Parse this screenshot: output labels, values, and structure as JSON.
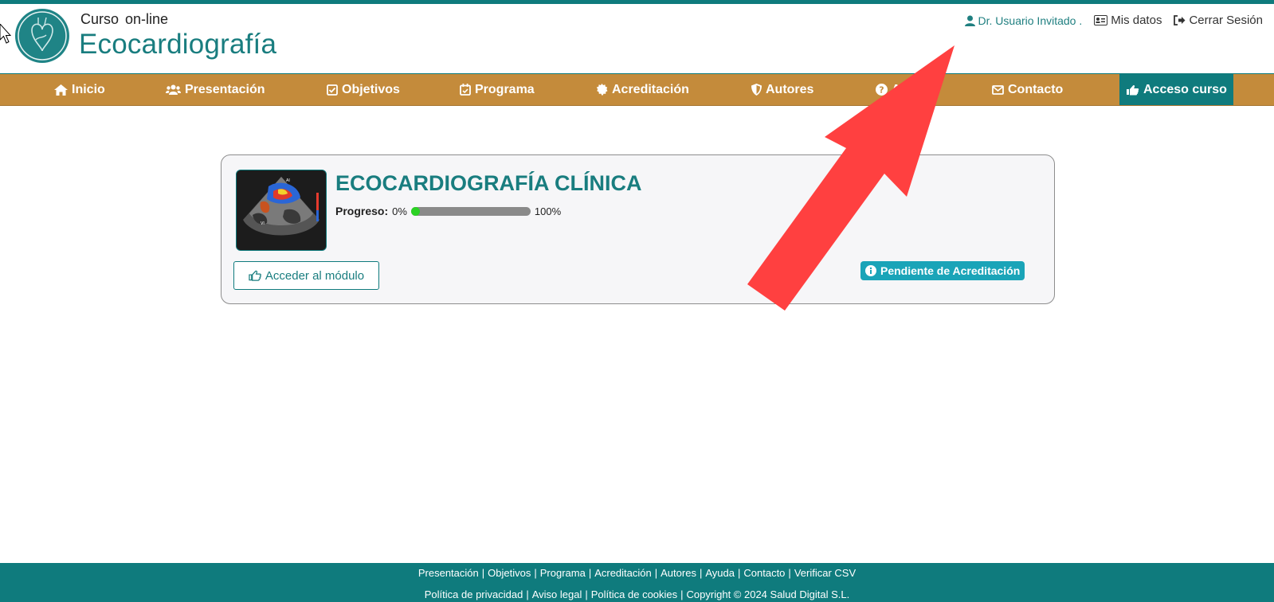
{
  "header": {
    "brand_small_1": "Curso",
    "brand_small_2": "on-line",
    "brand_big": "Ecocardiografía",
    "user_name": "Dr. Usuario Invitado .",
    "mis_datos": "Mis datos",
    "logout": "Cerrar Sesión"
  },
  "nav": {
    "items": [
      {
        "label": "Inicio",
        "icon": "home-icon"
      },
      {
        "label": "Presentación",
        "icon": "users-icon"
      },
      {
        "label": "Objetivos",
        "icon": "check-square-icon"
      },
      {
        "label": "Programa",
        "icon": "calendar-check-icon"
      },
      {
        "label": "Acreditación",
        "icon": "certificate-icon"
      },
      {
        "label": "Autores",
        "icon": "shield-icon"
      },
      {
        "label": "Ayuda",
        "icon": "question-circle-icon"
      },
      {
        "label": "Contacto",
        "icon": "envelope-icon"
      },
      {
        "label": "Acceso curso",
        "icon": "hand-point-icon"
      }
    ]
  },
  "course": {
    "title": "ECOCARDIOGRAFÍA CLÍNICA",
    "progress_label": "Progreso:",
    "progress_start": "0%",
    "progress_end": "100%",
    "progress_value": 0,
    "access_button": "Acceder al módulo",
    "status": "Pendiente de Acreditación"
  },
  "footer": {
    "row1": [
      "Presentación",
      "Objetivos",
      "Programa",
      "Acreditación",
      "Autores",
      "Ayuda",
      "Contacto",
      "Verificar CSV"
    ],
    "row2": [
      "Política de privacidad",
      "Aviso legal",
      "Política de cookies",
      "Copyright © 2024 Salud Digital S.L."
    ]
  },
  "colors": {
    "teal": "#0f7b7d",
    "nav_bg": "#c48b3b",
    "progress_fill": "#2bd224",
    "badge": "#1aa4b8",
    "arrow": "#ff4040"
  }
}
